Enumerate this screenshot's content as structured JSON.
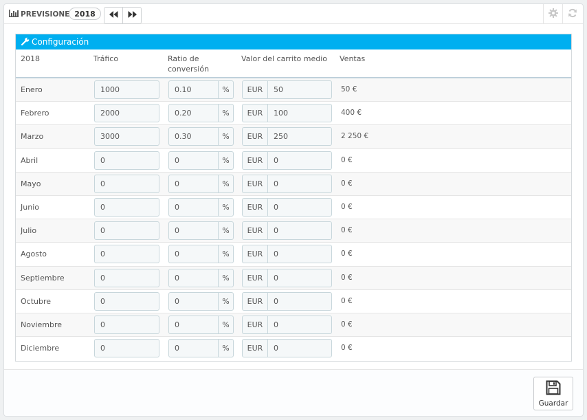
{
  "header": {
    "title": "PREVISIONES",
    "year": "2018",
    "icons": [
      "bar-chart-icon",
      "rewind-icon",
      "fast-forward-icon",
      "gear-icon",
      "refresh-icon"
    ]
  },
  "config": {
    "title": "Configuración",
    "columns": {
      "year": "2018",
      "traffic": "Tráfico",
      "conversion": "Ratio de conversión",
      "cart": "Valor del carrito medio",
      "sales": "Ventas"
    },
    "percent_symbol": "%",
    "currency": "EUR",
    "rows": [
      {
        "month": "Enero",
        "traffic": "1000",
        "conversion": "0.10",
        "cart": "50",
        "sales": "50 €"
      },
      {
        "month": "Febrero",
        "traffic": "2000",
        "conversion": "0.20",
        "cart": "100",
        "sales": "400 €"
      },
      {
        "month": "Marzo",
        "traffic": "3000",
        "conversion": "0.30",
        "cart": "250",
        "sales": "2 250 €"
      },
      {
        "month": "Abril",
        "traffic": "0",
        "conversion": "0",
        "cart": "0",
        "sales": "0 €"
      },
      {
        "month": "Mayo",
        "traffic": "0",
        "conversion": "0",
        "cart": "0",
        "sales": "0 €"
      },
      {
        "month": "Junio",
        "traffic": "0",
        "conversion": "0",
        "cart": "0",
        "sales": "0 €"
      },
      {
        "month": "Julio",
        "traffic": "0",
        "conversion": "0",
        "cart": "0",
        "sales": "0 €"
      },
      {
        "month": "Agosto",
        "traffic": "0",
        "conversion": "0",
        "cart": "0",
        "sales": "0 €"
      },
      {
        "month": "Septiembre",
        "traffic": "0",
        "conversion": "0",
        "cart": "0",
        "sales": "0 €"
      },
      {
        "month": "Octubre",
        "traffic": "0",
        "conversion": "0",
        "cart": "0",
        "sales": "0 €"
      },
      {
        "month": "Noviembre",
        "traffic": "0",
        "conversion": "0",
        "cart": "0",
        "sales": "0 €"
      },
      {
        "month": "Diciembre",
        "traffic": "0",
        "conversion": "0",
        "cart": "0",
        "sales": "0 €"
      }
    ]
  },
  "footer": {
    "save_label": "Guardar"
  },
  "colors": {
    "accent": "#00aff0",
    "input_bg": "#f5f8f9",
    "input_border": "#c7d6db"
  }
}
